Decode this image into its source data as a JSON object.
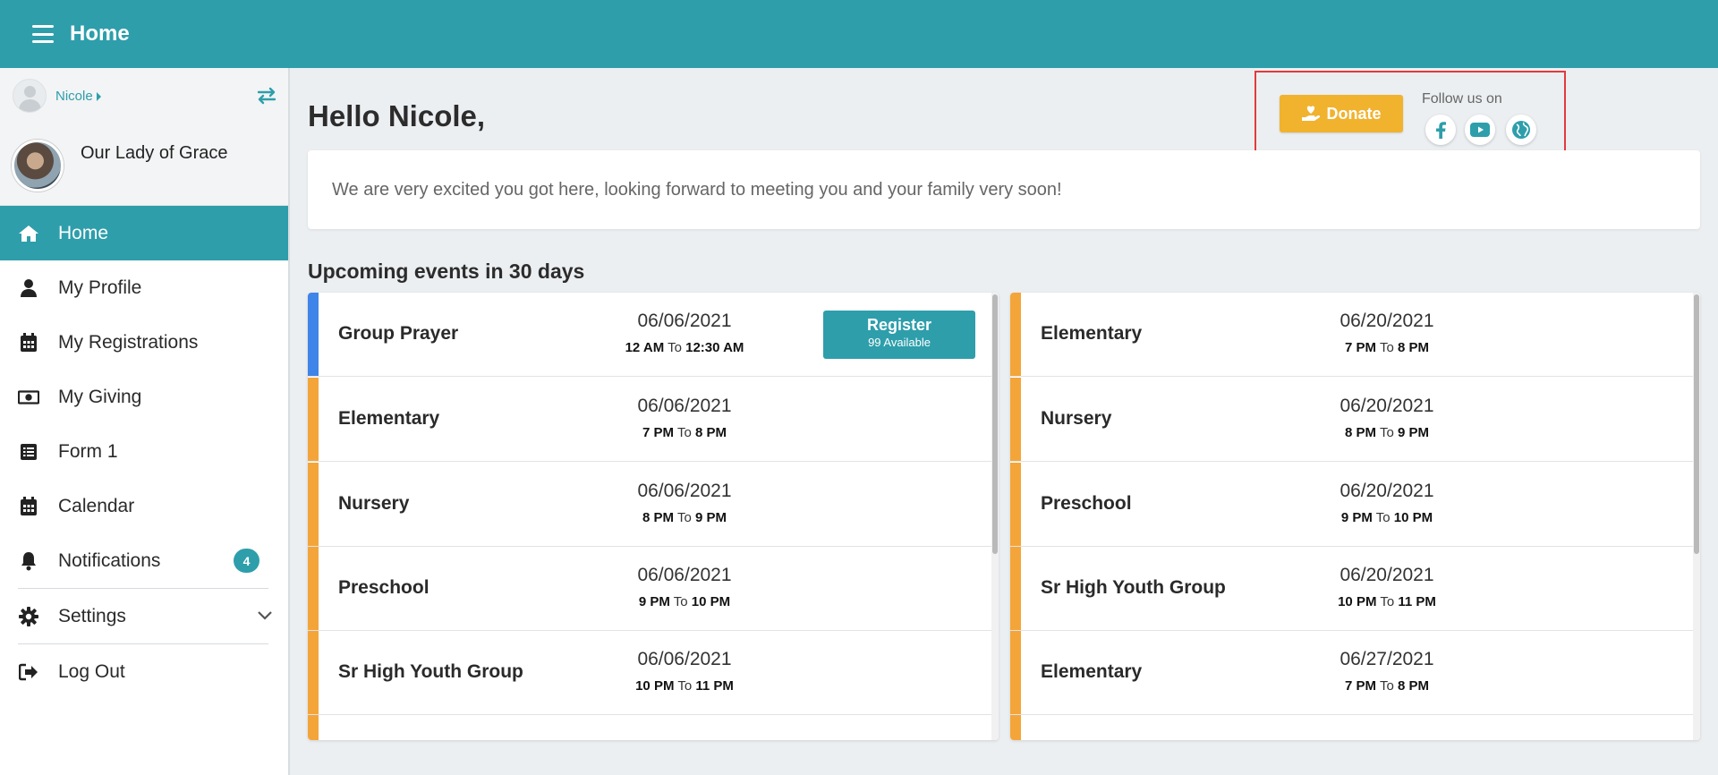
{
  "header": {
    "title": "Home"
  },
  "sidebar": {
    "user_name": "Nicole",
    "church_name": "Our Lady of Grace",
    "items": [
      {
        "label": "Home",
        "icon": "home-icon"
      },
      {
        "label": "My Profile",
        "icon": "user-icon"
      },
      {
        "label": "My Registrations",
        "icon": "calendar-icon"
      },
      {
        "label": "My Giving",
        "icon": "money-icon"
      },
      {
        "label": "Form 1",
        "icon": "list-icon"
      },
      {
        "label": "Calendar",
        "icon": "calendar-icon"
      },
      {
        "label": "Notifications",
        "icon": "bell-icon",
        "badge": "4"
      },
      {
        "label": "Settings",
        "icon": "gear-icon"
      },
      {
        "label": "Log Out",
        "icon": "logout-icon"
      }
    ]
  },
  "main": {
    "greeting": "Hello Nicole,",
    "donate_label": "Donate",
    "follow_label": "Follow us on",
    "welcome_text": "We are very excited you got here, looking forward to meeting you and your family very soon!",
    "events_title": "Upcoming events in 30 days",
    "time_separator": "To",
    "register_label": "Register",
    "register_available": "99 Available",
    "events_left": [
      {
        "name": "Group Prayer",
        "date": "06/06/2021",
        "start": "12 AM",
        "end": "12:30 AM"
      },
      {
        "name": "Elementary",
        "date": "06/06/2021",
        "start": "7 PM",
        "end": "8 PM"
      },
      {
        "name": "Nursery",
        "date": "06/06/2021",
        "start": "8 PM",
        "end": "9 PM"
      },
      {
        "name": "Preschool",
        "date": "06/06/2021",
        "start": "9 PM",
        "end": "10 PM"
      },
      {
        "name": "Sr High Youth Group",
        "date": "06/06/2021",
        "start": "10 PM",
        "end": "11 PM"
      }
    ],
    "events_right": [
      {
        "name": "Elementary",
        "date": "06/20/2021",
        "start": "7 PM",
        "end": "8 PM"
      },
      {
        "name": "Nursery",
        "date": "06/20/2021",
        "start": "8 PM",
        "end": "9 PM"
      },
      {
        "name": "Preschool",
        "date": "06/20/2021",
        "start": "9 PM",
        "end": "10 PM"
      },
      {
        "name": "Sr High Youth Group",
        "date": "06/20/2021",
        "start": "10 PM",
        "end": "11 PM"
      },
      {
        "name": "Elementary",
        "date": "06/27/2021",
        "start": "7 PM",
        "end": "8 PM"
      }
    ]
  },
  "colors": {
    "primary": "#2e9eab",
    "donate": "#f1b22e",
    "event_bar": "#f4a53a",
    "event_bar_highlight": "#3f84e8"
  }
}
